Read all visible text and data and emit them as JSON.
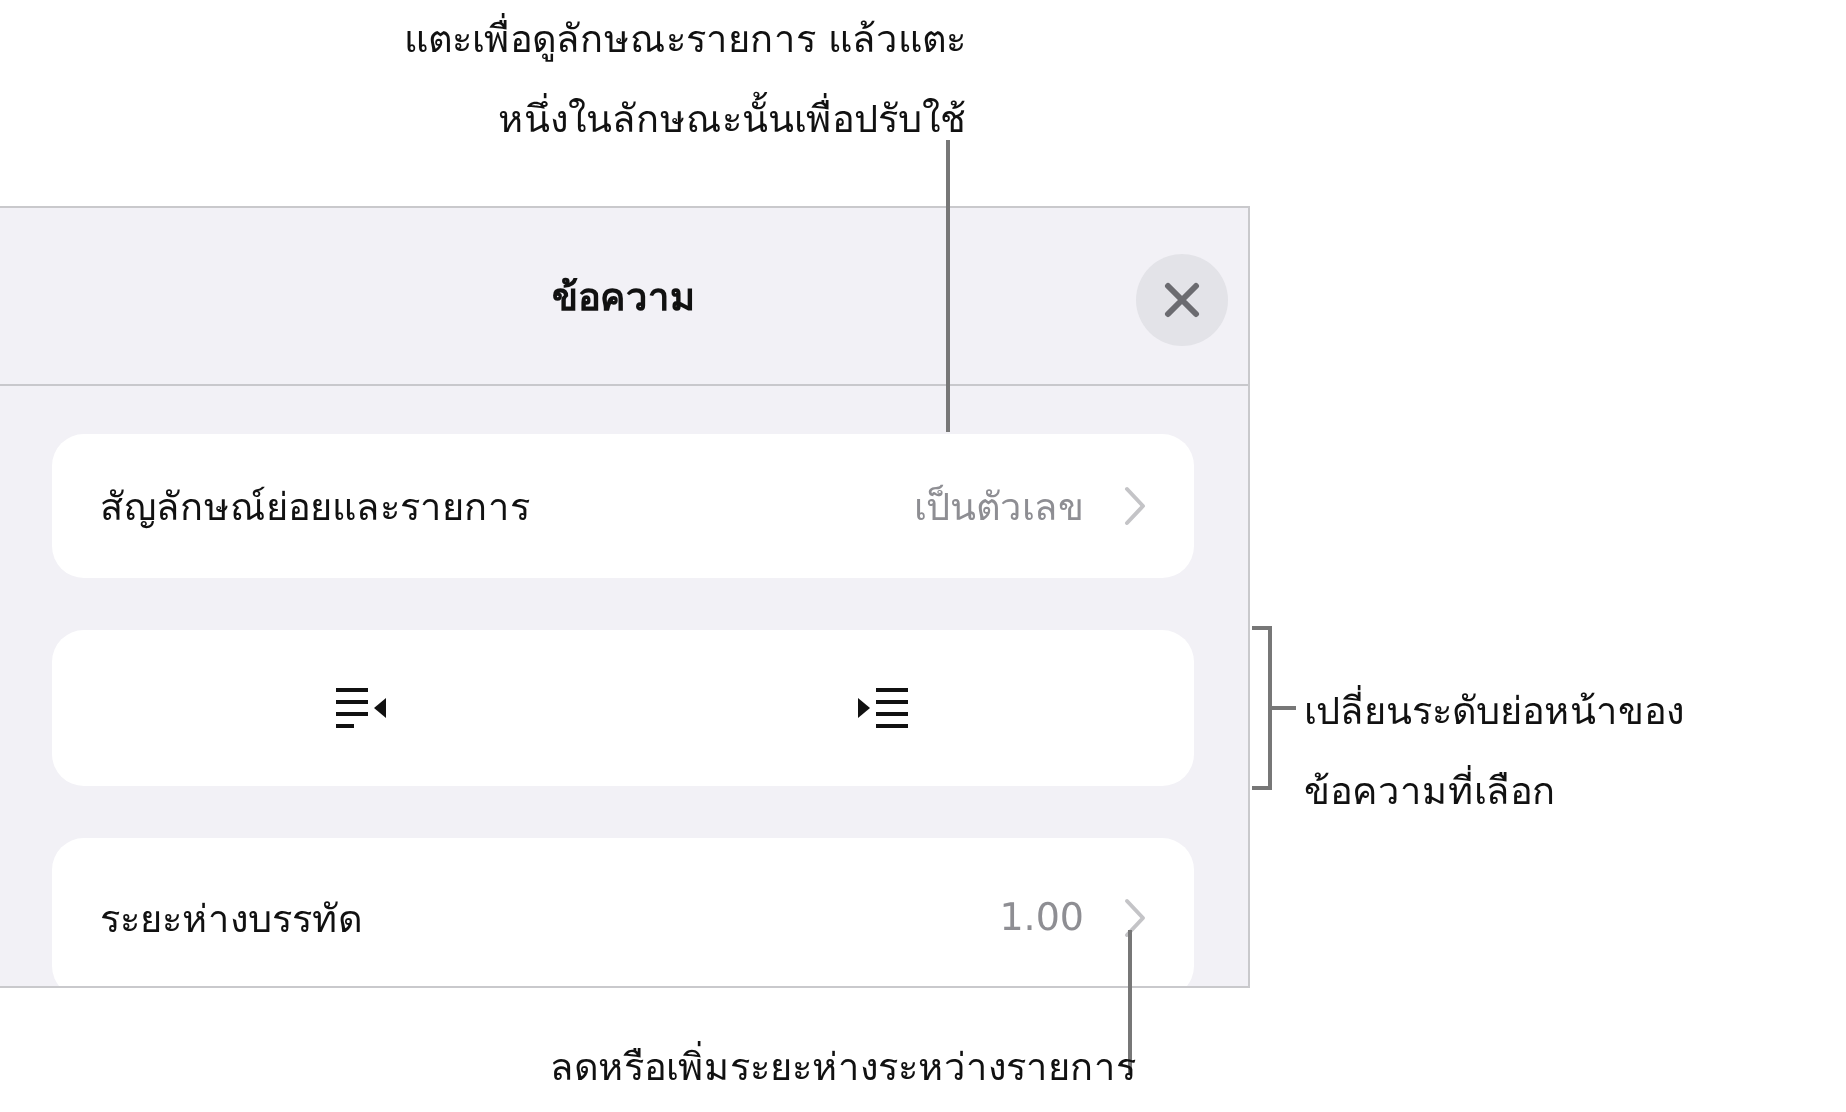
{
  "callouts": [
    {
      "kind": "top",
      "lines": [
        "แตะเพื่อดูลักษณะรายการ แล้วแตะ",
        "หนึ่งในลักษณะนั้นเพื่อปรับใช้"
      ]
    },
    {
      "kind": "bracket",
      "lines": [
        "เปลี่ยนระดับย่อหน้าของ",
        "ข้อความที่เลือก"
      ]
    },
    {
      "kind": "bottom",
      "lines": [
        "ลดหรือเพิ่มระยะห่างระหว่างรายการ"
      ]
    }
  ],
  "panel": {
    "title": "ข้อความ",
    "rows": [
      {
        "kind": "disclosure",
        "label": "สัญลักษณ์ย่อยและรายการ",
        "value": "เป็นตัวเลข"
      },
      {
        "kind": "indent"
      },
      {
        "kind": "disclosure",
        "label": "ระยะห่างบรรทัด",
        "value": "1.00"
      }
    ]
  }
}
